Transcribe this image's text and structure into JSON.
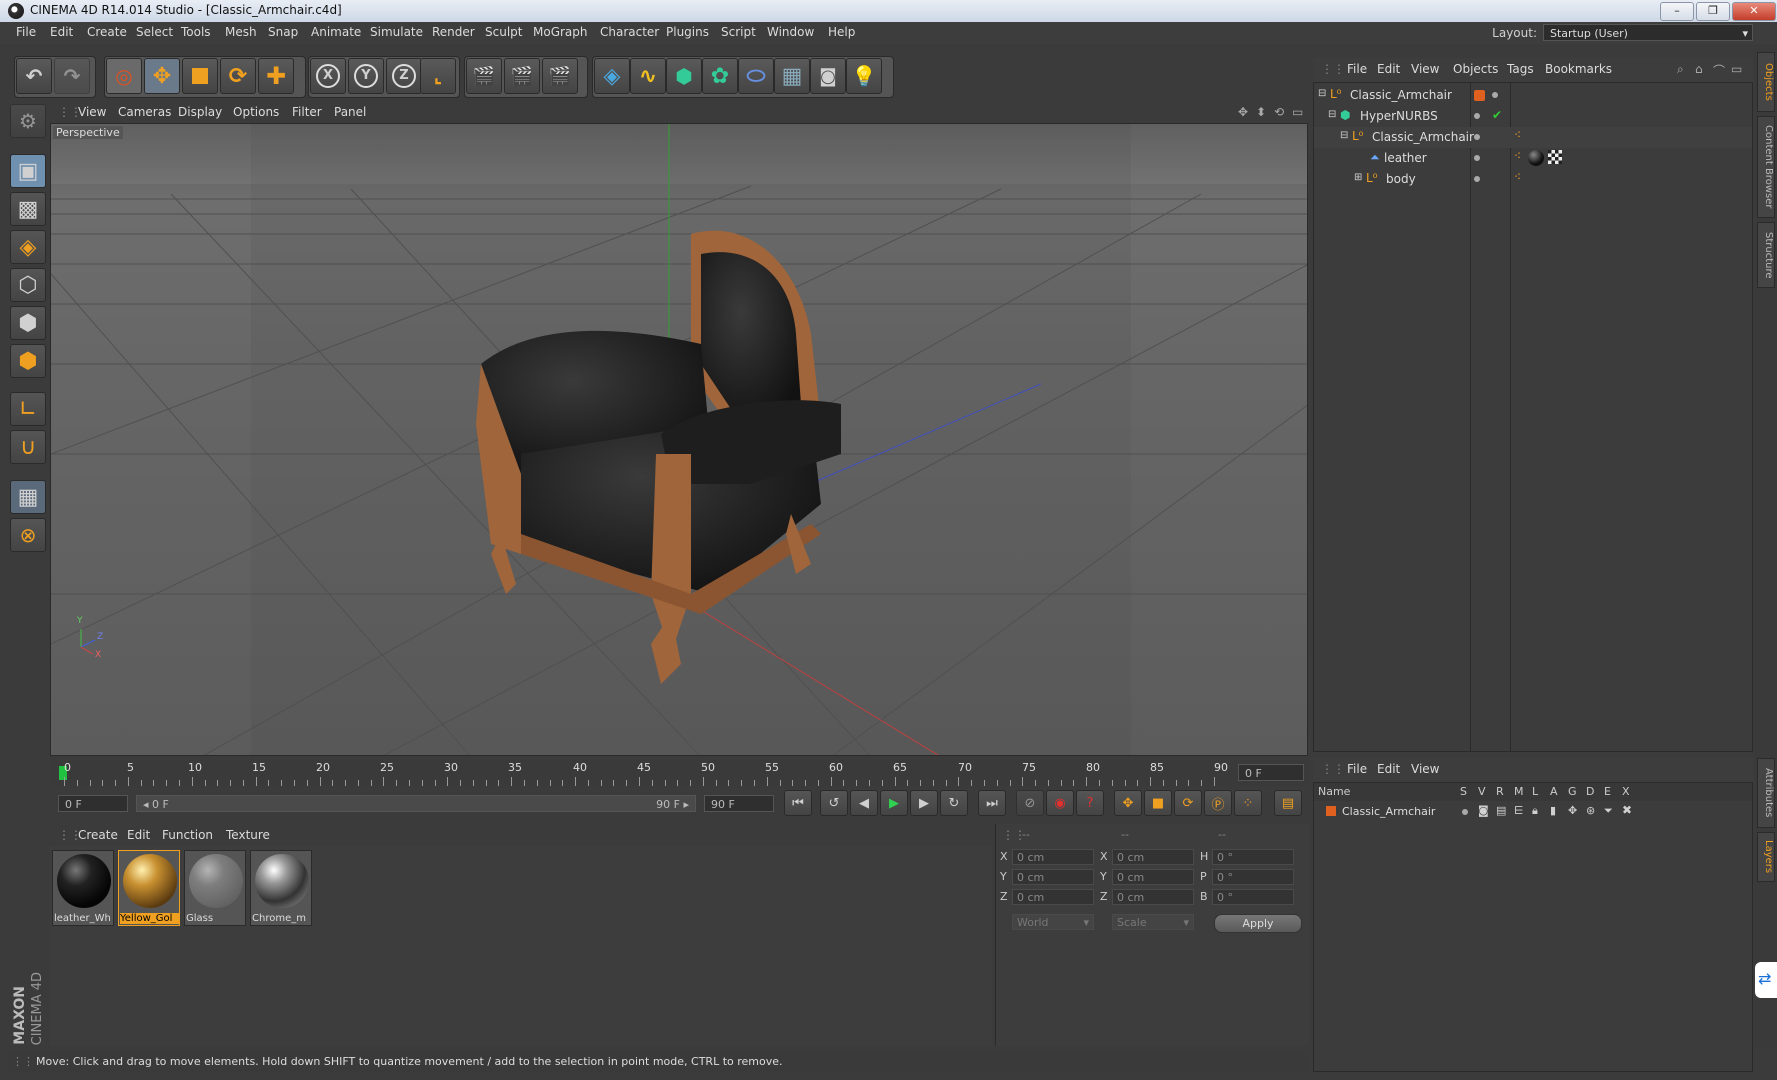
{
  "window": {
    "title": "CINEMA 4D R14.014 Studio - [Classic_Armchair.c4d]",
    "minimize": "–",
    "maximize": "❐",
    "close": "✕"
  },
  "menubar": {
    "items": [
      "File",
      "Edit",
      "Create",
      "Select",
      "Tools",
      "Mesh",
      "Snap",
      "Animate",
      "Simulate",
      "Render",
      "Sculpt",
      "MoGraph",
      "Character",
      "Plugins",
      "Script",
      "Window",
      "Help"
    ],
    "layout_label": "Layout:",
    "layout_value": "Startup (User)"
  },
  "toolbar": {
    "x_label": "X",
    "y_label": "Y",
    "z_label": "Z"
  },
  "viewport": {
    "menu": [
      "View",
      "Cameras",
      "Display",
      "Options",
      "Filter",
      "Panel"
    ],
    "label": "Perspective",
    "axis_y": "Y",
    "axis_z": "Z",
    "axis_x": "X"
  },
  "timeline": {
    "ticks": [
      "0",
      "5",
      "10",
      "15",
      "20",
      "25",
      "30",
      "35",
      "40",
      "45",
      "50",
      "55",
      "60",
      "65",
      "70",
      "75",
      "80",
      "85",
      "90"
    ],
    "current_frame": "0 F"
  },
  "playback": {
    "start_field": "0 F",
    "range_start": "◂ 0 F",
    "range_end": "90 F ▸",
    "end_field": "90 F"
  },
  "materials": {
    "menu": [
      "Create",
      "Edit",
      "Function",
      "Texture"
    ],
    "items": [
      {
        "label": "leather_Wh"
      },
      {
        "label": "Yellow_Gol"
      },
      {
        "label": "Glass"
      },
      {
        "label": "Chrome_m"
      }
    ]
  },
  "coords": {
    "headers": [
      "--",
      "--",
      "--"
    ],
    "rows": [
      {
        "l1": "X",
        "v1": "0 cm",
        "l2": "X",
        "v2": "0 cm",
        "l3": "H",
        "v3": "0 °"
      },
      {
        "l1": "Y",
        "v1": "0 cm",
        "l2": "Y",
        "v2": "0 cm",
        "l3": "P",
        "v3": "0 °"
      },
      {
        "l1": "Z",
        "v1": "0 cm",
        "l2": "Z",
        "v2": "0 cm",
        "l3": "B",
        "v3": "0 °"
      }
    ],
    "world": "World",
    "scale": "Scale",
    "apply": "Apply"
  },
  "status": {
    "text": "Move: Click and drag to move elements. Hold down SHIFT to quantize movement / add to the selection in point mode, CTRL to remove."
  },
  "objects": {
    "menu": [
      "File",
      "Edit",
      "View",
      "Objects",
      "Tags",
      "Bookmarks"
    ],
    "tree": [
      {
        "name": "Classic_Armchair"
      },
      {
        "name": "HyperNURBS"
      },
      {
        "name": "Classic_Armchair"
      },
      {
        "name": "leather"
      },
      {
        "name": "body"
      }
    ]
  },
  "layers": {
    "menu": [
      "File",
      "Edit",
      "View"
    ],
    "headers": [
      "Name",
      "S",
      "V",
      "R",
      "M",
      "L",
      "A",
      "G",
      "D",
      "E",
      "X"
    ],
    "rows": [
      {
        "name": "Classic_Armchair"
      }
    ]
  },
  "edgetabs": [
    "Objects",
    "Content Browser",
    "Structure",
    "Attributes",
    "Layers"
  ],
  "branding": {
    "maxon": "MAXON",
    "c4d": "CINEMA 4D"
  },
  "colors": {
    "accent": "#f0a020",
    "bg": "#3b3b3b",
    "wood": "#a0653a",
    "leather": "#1c1c1c"
  }
}
